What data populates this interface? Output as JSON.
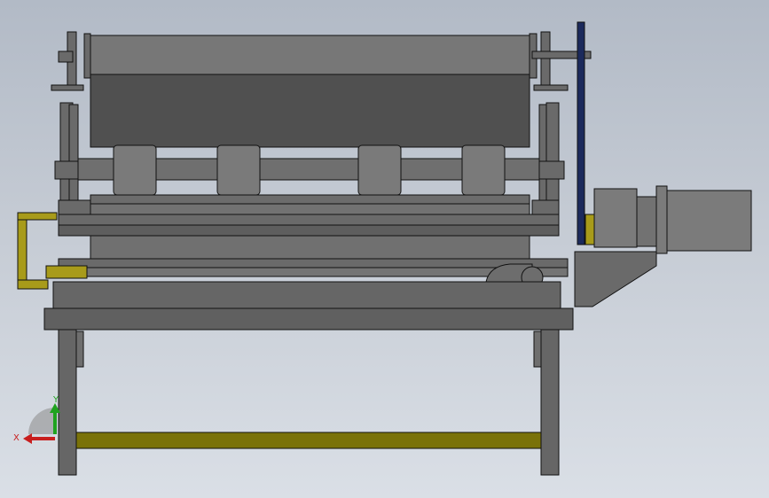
{
  "triad": {
    "x_label": "X",
    "y_label": "Y",
    "x_color": "#c81e1e",
    "y_color": "#1fa21f"
  },
  "colors": {
    "background_top": "#b2bac6",
    "background_bottom": "#dadfe6",
    "frame": "#646464",
    "panel": "#505050",
    "roller": "#7a7a7a",
    "roller_dark": "#6a6a6a",
    "yellow_bar": "#7a7209",
    "yellow_bar_light": "#a89b1a",
    "belt": "#1c2a5c",
    "motor": "#7b7b7b",
    "outline": "#111111"
  }
}
